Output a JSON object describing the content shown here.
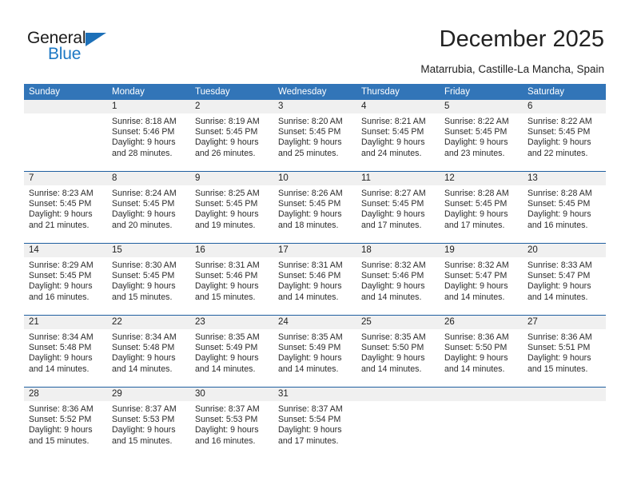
{
  "brand": {
    "word_one": "General",
    "word_two": "Blue",
    "triangle_color": "#1d70b8",
    "blue_text_color": "#1d78c4"
  },
  "header": {
    "title": "December 2025",
    "location": "Matarrubia, Castille-La Mancha, Spain"
  },
  "theme": {
    "header_blue": "#3275b8",
    "separator_blue": "#1f5fa0",
    "date_band_gray": "#f0f0f0"
  },
  "weekday_headers": [
    "Sunday",
    "Monday",
    "Tuesday",
    "Wednesday",
    "Thursday",
    "Friday",
    "Saturday"
  ],
  "weeks": [
    {
      "days": [
        {
          "date": "",
          "l1": "",
          "l2": "",
          "l3": "",
          "l4": ""
        },
        {
          "date": "1",
          "l1": "Sunrise: 8:18 AM",
          "l2": "Sunset: 5:46 PM",
          "l3": "Daylight: 9 hours",
          "l4": "and 28 minutes."
        },
        {
          "date": "2",
          "l1": "Sunrise: 8:19 AM",
          "l2": "Sunset: 5:45 PM",
          "l3": "Daylight: 9 hours",
          "l4": "and 26 minutes."
        },
        {
          "date": "3",
          "l1": "Sunrise: 8:20 AM",
          "l2": "Sunset: 5:45 PM",
          "l3": "Daylight: 9 hours",
          "l4": "and 25 minutes."
        },
        {
          "date": "4",
          "l1": "Sunrise: 8:21 AM",
          "l2": "Sunset: 5:45 PM",
          "l3": "Daylight: 9 hours",
          "l4": "and 24 minutes."
        },
        {
          "date": "5",
          "l1": "Sunrise: 8:22 AM",
          "l2": "Sunset: 5:45 PM",
          "l3": "Daylight: 9 hours",
          "l4": "and 23 minutes."
        },
        {
          "date": "6",
          "l1": "Sunrise: 8:22 AM",
          "l2": "Sunset: 5:45 PM",
          "l3": "Daylight: 9 hours",
          "l4": "and 22 minutes."
        }
      ]
    },
    {
      "days": [
        {
          "date": "7",
          "l1": "Sunrise: 8:23 AM",
          "l2": "Sunset: 5:45 PM",
          "l3": "Daylight: 9 hours",
          "l4": "and 21 minutes."
        },
        {
          "date": "8",
          "l1": "Sunrise: 8:24 AM",
          "l2": "Sunset: 5:45 PM",
          "l3": "Daylight: 9 hours",
          "l4": "and 20 minutes."
        },
        {
          "date": "9",
          "l1": "Sunrise: 8:25 AM",
          "l2": "Sunset: 5:45 PM",
          "l3": "Daylight: 9 hours",
          "l4": "and 19 minutes."
        },
        {
          "date": "10",
          "l1": "Sunrise: 8:26 AM",
          "l2": "Sunset: 5:45 PM",
          "l3": "Daylight: 9 hours",
          "l4": "and 18 minutes."
        },
        {
          "date": "11",
          "l1": "Sunrise: 8:27 AM",
          "l2": "Sunset: 5:45 PM",
          "l3": "Daylight: 9 hours",
          "l4": "and 17 minutes."
        },
        {
          "date": "12",
          "l1": "Sunrise: 8:28 AM",
          "l2": "Sunset: 5:45 PM",
          "l3": "Daylight: 9 hours",
          "l4": "and 17 minutes."
        },
        {
          "date": "13",
          "l1": "Sunrise: 8:28 AM",
          "l2": "Sunset: 5:45 PM",
          "l3": "Daylight: 9 hours",
          "l4": "and 16 minutes."
        }
      ]
    },
    {
      "days": [
        {
          "date": "14",
          "l1": "Sunrise: 8:29 AM",
          "l2": "Sunset: 5:45 PM",
          "l3": "Daylight: 9 hours",
          "l4": "and 16 minutes."
        },
        {
          "date": "15",
          "l1": "Sunrise: 8:30 AM",
          "l2": "Sunset: 5:45 PM",
          "l3": "Daylight: 9 hours",
          "l4": "and 15 minutes."
        },
        {
          "date": "16",
          "l1": "Sunrise: 8:31 AM",
          "l2": "Sunset: 5:46 PM",
          "l3": "Daylight: 9 hours",
          "l4": "and 15 minutes."
        },
        {
          "date": "17",
          "l1": "Sunrise: 8:31 AM",
          "l2": "Sunset: 5:46 PM",
          "l3": "Daylight: 9 hours",
          "l4": "and 14 minutes."
        },
        {
          "date": "18",
          "l1": "Sunrise: 8:32 AM",
          "l2": "Sunset: 5:46 PM",
          "l3": "Daylight: 9 hours",
          "l4": "and 14 minutes."
        },
        {
          "date": "19",
          "l1": "Sunrise: 8:32 AM",
          "l2": "Sunset: 5:47 PM",
          "l3": "Daylight: 9 hours",
          "l4": "and 14 minutes."
        },
        {
          "date": "20",
          "l1": "Sunrise: 8:33 AM",
          "l2": "Sunset: 5:47 PM",
          "l3": "Daylight: 9 hours",
          "l4": "and 14 minutes."
        }
      ]
    },
    {
      "days": [
        {
          "date": "21",
          "l1": "Sunrise: 8:34 AM",
          "l2": "Sunset: 5:48 PM",
          "l3": "Daylight: 9 hours",
          "l4": "and 14 minutes."
        },
        {
          "date": "22",
          "l1": "Sunrise: 8:34 AM",
          "l2": "Sunset: 5:48 PM",
          "l3": "Daylight: 9 hours",
          "l4": "and 14 minutes."
        },
        {
          "date": "23",
          "l1": "Sunrise: 8:35 AM",
          "l2": "Sunset: 5:49 PM",
          "l3": "Daylight: 9 hours",
          "l4": "and 14 minutes."
        },
        {
          "date": "24",
          "l1": "Sunrise: 8:35 AM",
          "l2": "Sunset: 5:49 PM",
          "l3": "Daylight: 9 hours",
          "l4": "and 14 minutes."
        },
        {
          "date": "25",
          "l1": "Sunrise: 8:35 AM",
          "l2": "Sunset: 5:50 PM",
          "l3": "Daylight: 9 hours",
          "l4": "and 14 minutes."
        },
        {
          "date": "26",
          "l1": "Sunrise: 8:36 AM",
          "l2": "Sunset: 5:50 PM",
          "l3": "Daylight: 9 hours",
          "l4": "and 14 minutes."
        },
        {
          "date": "27",
          "l1": "Sunrise: 8:36 AM",
          "l2": "Sunset: 5:51 PM",
          "l3": "Daylight: 9 hours",
          "l4": "and 15 minutes."
        }
      ]
    },
    {
      "days": [
        {
          "date": "28",
          "l1": "Sunrise: 8:36 AM",
          "l2": "Sunset: 5:52 PM",
          "l3": "Daylight: 9 hours",
          "l4": "and 15 minutes."
        },
        {
          "date": "29",
          "l1": "Sunrise: 8:37 AM",
          "l2": "Sunset: 5:53 PM",
          "l3": "Daylight: 9 hours",
          "l4": "and 15 minutes."
        },
        {
          "date": "30",
          "l1": "Sunrise: 8:37 AM",
          "l2": "Sunset: 5:53 PM",
          "l3": "Daylight: 9 hours",
          "l4": "and 16 minutes."
        },
        {
          "date": "31",
          "l1": "Sunrise: 8:37 AM",
          "l2": "Sunset: 5:54 PM",
          "l3": "Daylight: 9 hours",
          "l4": "and 17 minutes."
        },
        {
          "date": "",
          "l1": "",
          "l2": "",
          "l3": "",
          "l4": ""
        },
        {
          "date": "",
          "l1": "",
          "l2": "",
          "l3": "",
          "l4": ""
        },
        {
          "date": "",
          "l1": "",
          "l2": "",
          "l3": "",
          "l4": ""
        }
      ]
    }
  ]
}
